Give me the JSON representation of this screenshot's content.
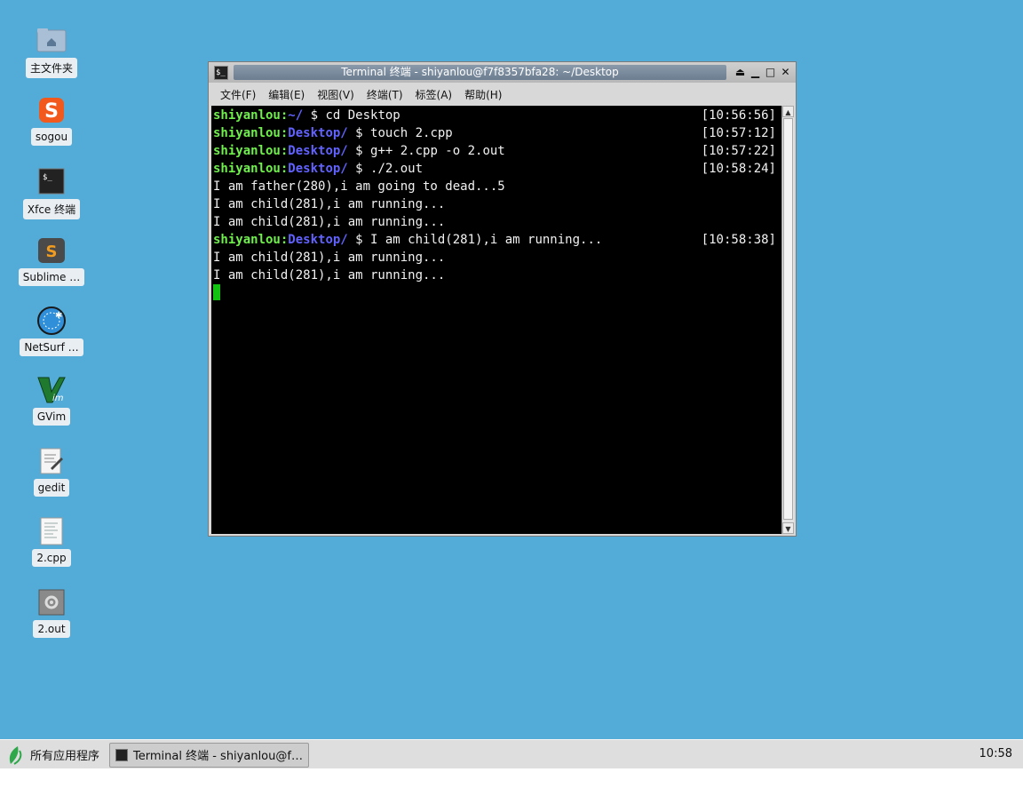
{
  "desktop": {
    "icons": [
      {
        "label": "主文件夹",
        "icon": "home-folder-icon"
      },
      {
        "label": "sogou",
        "icon": "sogou-icon"
      },
      {
        "label": "Xfce 终端",
        "icon": "terminal-icon"
      },
      {
        "label": "Sublime …",
        "icon": "sublime-icon"
      },
      {
        "label": "NetSurf …",
        "icon": "netsurf-icon"
      },
      {
        "label": "GVim",
        "icon": "gvim-icon"
      },
      {
        "label": "gedit",
        "icon": "gedit-icon"
      },
      {
        "label": "2.cpp",
        "icon": "text-file-icon"
      },
      {
        "label": "2.out",
        "icon": "executable-icon"
      }
    ]
  },
  "window": {
    "title": "Terminal 终端 - shiyanlou@f7f8357bfa28: ~/Desktop",
    "menu": [
      "文件(F)",
      "编辑(E)",
      "视图(V)",
      "终端(T)",
      "标签(A)",
      "帮助(H)"
    ]
  },
  "terminal": {
    "lines": [
      {
        "user": "shiyanlou",
        "path": "~/",
        "cmd": " $ cd Desktop",
        "time": "[10:56:56]"
      },
      {
        "user": "shiyanlou",
        "path": "Desktop/",
        "cmd": " $ touch 2.cpp",
        "time": "[10:57:12]"
      },
      {
        "user": "shiyanlou",
        "path": "Desktop/",
        "cmd": " $ g++ 2.cpp -o 2.out",
        "time": "[10:57:22]"
      },
      {
        "user": "shiyanlou",
        "path": "Desktop/",
        "cmd": " $ ./2.out",
        "time": "[10:58:24]"
      },
      {
        "text": "I am father(280),i am going to dead...5"
      },
      {
        "text": "I am child(281),i am running..."
      },
      {
        "text": "I am child(281),i am running..."
      },
      {
        "user": "shiyanlou",
        "path": "Desktop/",
        "cmd": " $ I am child(281),i am running...",
        "time": "[10:58:38]"
      },
      {
        "text": "I am child(281),i am running..."
      },
      {
        "text": "I am child(281),i am running..."
      }
    ]
  },
  "taskbar": {
    "app_menu": "所有应用程序",
    "task_label": "Terminal 终端 - shiyanlou@f…",
    "clock": "10:58"
  }
}
